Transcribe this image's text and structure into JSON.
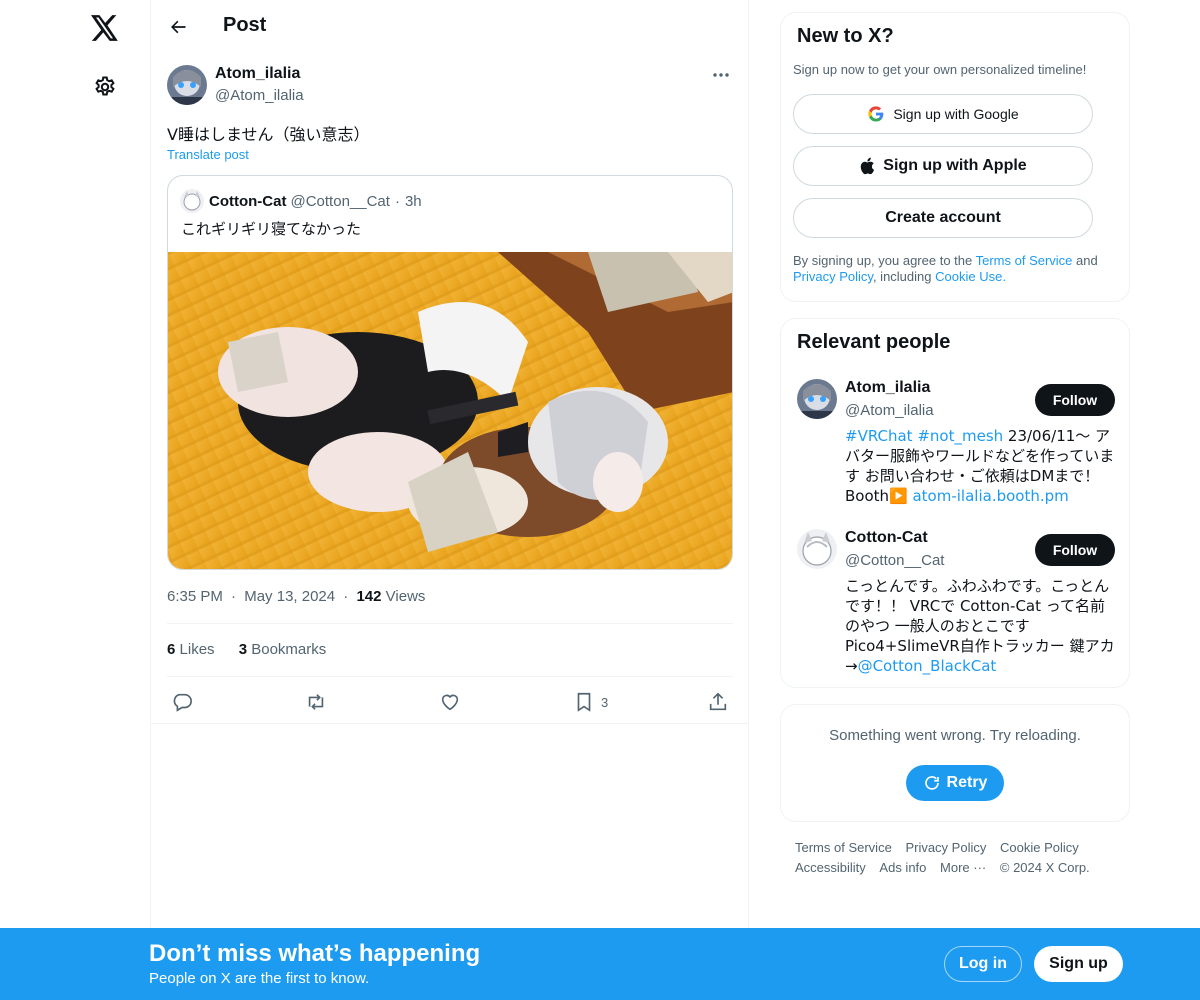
{
  "nav": {
    "logo_icon": "x-logo-icon",
    "settings_icon": "gear-icon"
  },
  "header": {
    "title": "Post"
  },
  "post": {
    "author_name": "Atom_ilalia",
    "author_handle": "@Atom_ilalia",
    "text": "V睡はしません（強い意志）",
    "translate_label": "Translate post",
    "quote": {
      "name": "Cotton-Cat",
      "handle": "@Cotton__Cat",
      "separator": "·",
      "time": "3h",
      "text": "これギリギリ寝てなかった"
    },
    "time": "6:35 PM",
    "date": "May 13, 2024",
    "dot": "·",
    "views_count": "142",
    "views_label": "Views",
    "likes_count": "6",
    "likes_label": "Likes",
    "bookmarks_count": "3",
    "bookmarks_label": "Bookmarks",
    "bookmark_action_count": "3"
  },
  "new_to_x": {
    "title": "New to X?",
    "subtitle": "Sign up now to get your own personalized timeline!",
    "google_label": "Sign up with Google",
    "apple_label": "Sign up with Apple",
    "create_label": "Create account",
    "legal_prefix": "By signing up, you agree to the ",
    "terms_link": "Terms of Service",
    "legal_and": " and ",
    "privacy_link": "Privacy Policy",
    "legal_including": ", including ",
    "cookie_link": "Cookie Use",
    "legal_end": "."
  },
  "relevant_people": {
    "title": "Relevant people",
    "people": [
      {
        "name": "Atom_ilalia",
        "handle": "@Atom_ilalia",
        "follow_label": "Follow",
        "bio_tag1": "#VRChat",
        "bio_tag2": "#not_mesh",
        "bio_text": " 23/06/11〜 アバター服飾やワールドなどを作っています お問い合わせ・ご依頼はDMまで！ Booth▶️ ",
        "bio_link": "atom-ilalia.booth.pm"
      },
      {
        "name": "Cotton-Cat",
        "handle": "@Cotton__Cat",
        "follow_label": "Follow",
        "bio_text": "こっとんです。ふわふわです。こっとんです！！ VRCで Cotton-Cat って名前のやつ 一般人のおとこです Pico4+SlimeVR自作トラッカー 鍵アカ→",
        "bio_link": "@Cotton_BlackCat"
      }
    ]
  },
  "error_card": {
    "message": "Something went wrong. Try reloading.",
    "retry_label": "Retry"
  },
  "footer": {
    "links": [
      "Terms of Service",
      "Privacy Policy",
      "Cookie Policy",
      "Accessibility",
      "Ads info",
      "More ···",
      "© 2024 X Corp."
    ]
  },
  "bottom_bar": {
    "title": "Don’t miss what’s happening",
    "subtitle": "People on X are the first to know.",
    "login_label": "Log in",
    "signup_label": "Sign up"
  },
  "colors": {
    "accent": "#1d9bf0",
    "text": "#0f1419",
    "muted": "#536471"
  }
}
